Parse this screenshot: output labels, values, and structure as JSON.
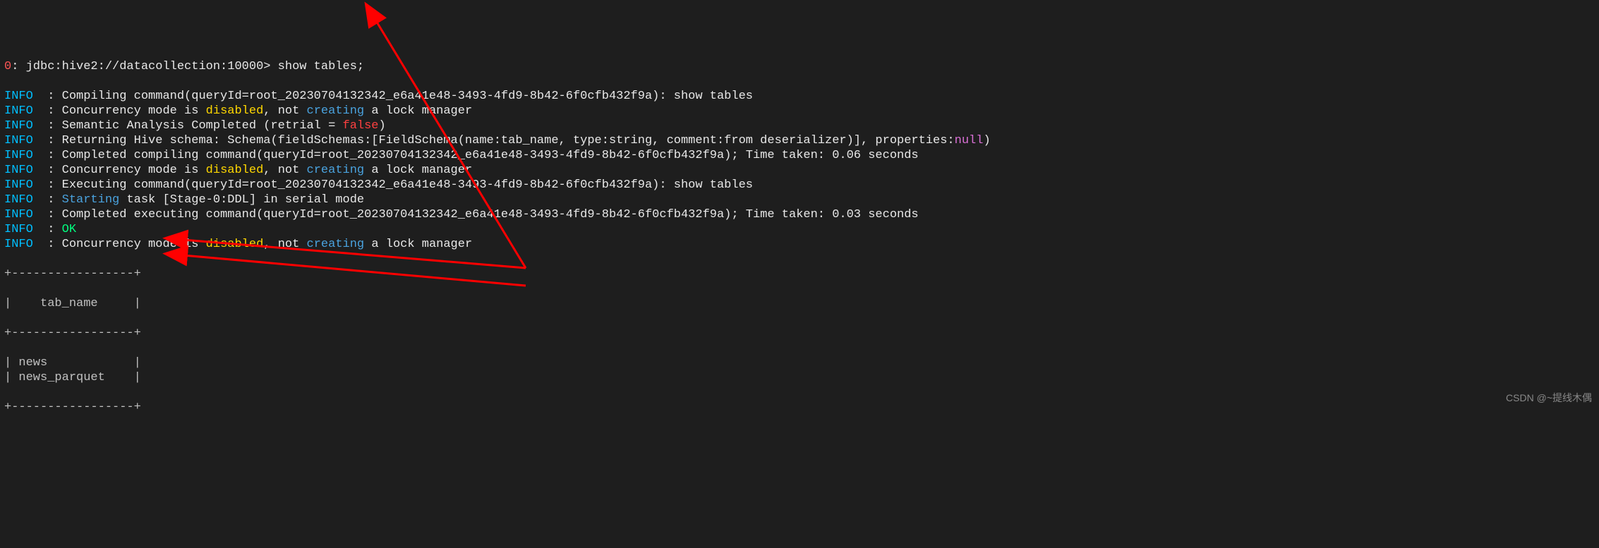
{
  "prompt": {
    "num": "0",
    "connection": "jdbc:hive2://datacollection:10000",
    "command": "show tables;"
  },
  "log_lines": [
    {
      "level": "INFO",
      "text": "Compiling command(queryId=root_20230704132342_e6a41e48-3493-4fd9-8b42-6f0cfb432f9a): show tables"
    },
    {
      "level": "INFO",
      "pre": "Concurrency mode is ",
      "kw1": "disabled",
      "mid": ", not ",
      "kw2": "creating",
      "post": " a lock manager"
    },
    {
      "level": "INFO",
      "pre": "Semantic Analysis Completed (retrial = ",
      "kw1": "false",
      "post": ")"
    },
    {
      "level": "INFO",
      "pre": "Returning Hive schema: Schema(fieldSchemas:[FieldSchema(name:tab_name, type:string, comment:from deserializer)], properties:",
      "kw1": "null",
      "post": ")"
    },
    {
      "level": "INFO",
      "text": "Completed compiling command(queryId=root_20230704132342_e6a41e48-3493-4fd9-8b42-6f0cfb432f9a); Time taken: 0.06 seconds"
    },
    {
      "level": "INFO",
      "pre": "Concurrency mode is ",
      "kw1": "disabled",
      "mid": ", not ",
      "kw2": "creating",
      "post": " a lock manager"
    },
    {
      "level": "INFO",
      "text": "Executing command(queryId=root_20230704132342_e6a41e48-3493-4fd9-8b42-6f0cfb432f9a): show tables"
    },
    {
      "level": "INFO",
      "kw1": "Starting",
      "post": " task [Stage-0:DDL] in serial mode"
    },
    {
      "level": "INFO",
      "text": "Completed executing command(queryId=root_20230704132342_e6a41e48-3493-4fd9-8b42-6f0cfb432f9a); Time taken: 0.03 seconds"
    },
    {
      "level": "INFO",
      "ok": "OK"
    },
    {
      "level": "INFO",
      "pre": "Concurrency mode is ",
      "kw1": "disabled",
      "mid": ", not ",
      "kw2": "creating",
      "post": " a lock manager"
    }
  ],
  "table": {
    "border": "+-----------------+",
    "header": "|    tab_name     |",
    "rows": [
      "| news            |",
      "| news_parquet    |"
    ]
  },
  "watermark": "CSDN @~提线木偶"
}
